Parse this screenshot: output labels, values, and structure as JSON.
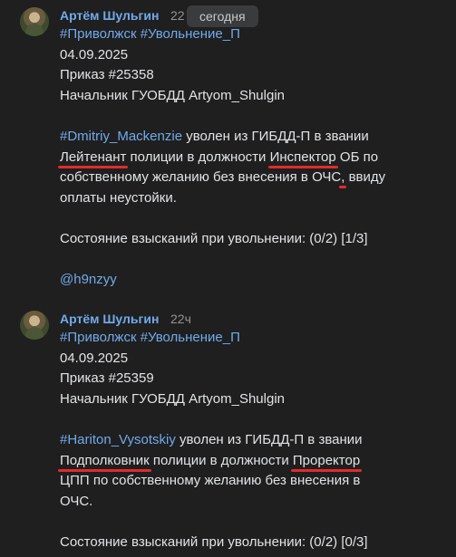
{
  "posts": [
    {
      "author": "Артём Шульгин",
      "time": "22",
      "tooltip": "сегодня",
      "hashtags": [
        "#Приволжск",
        "#Увольнение_П"
      ],
      "date": "04.09.2025",
      "order": "Приказ #25358",
      "chief": "Начальник ГУОБДД Artyom_Shulgin",
      "person": "#Dmitriy_Mackenzie",
      "text1": " уволен из ГИБДД-П в звании",
      "rank": "Лейтенант",
      "text2": " полиции в должности ",
      "position": "Инспектор",
      "text3": " ОБ по",
      "text4": "собственному желанию без внесения в ОЧС",
      "comma": ",",
      "text5": " ввиду",
      "text6": "оплаты неустойки.",
      "status": "Состояние взысканий при увольнении: (0/2) [1/3]",
      "mention": "@h9nzyy"
    },
    {
      "author": "Артём Шульгин",
      "time": "22ч",
      "hashtags": [
        "#Приволжск",
        "#Увольнение_П"
      ],
      "date": "04.09.2025",
      "order": "Приказ #25359",
      "chief": "Начальник ГУОБДД Artyom_Shulgin",
      "person": "#Hariton_Vysotskiy",
      "text1": " уволен из ГИБДД-П в звании",
      "rank": "Подполковник",
      "text2": " полиции в должности ",
      "position": "Проректор",
      "text3": "ЦПП по собственному желанию без внесения в",
      "text4": "ОЧС.",
      "status": "Состояние взысканий при увольнении: (0/2) [0/3]"
    }
  ],
  "colors": {
    "background": "#1f1f1f",
    "link": "#71aaeb",
    "text": "#e1e3e6",
    "underline": "#e12b2b"
  }
}
